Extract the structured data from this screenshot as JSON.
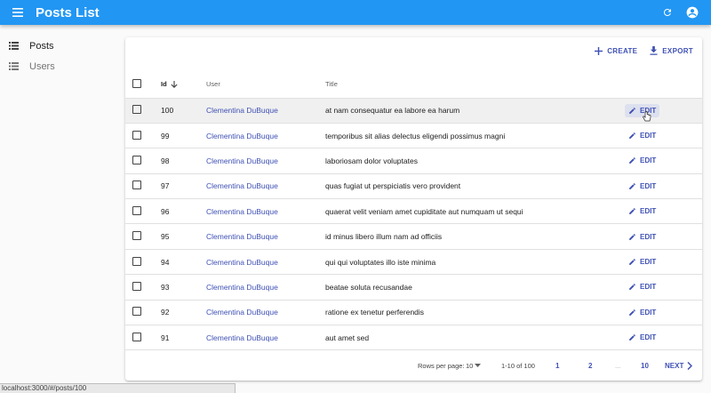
{
  "header": {
    "title": "Posts List",
    "menu_icon": "menu-icon",
    "refresh_icon": "refresh-icon",
    "account_icon": "account-circle-icon"
  },
  "sidebar": {
    "items": [
      {
        "label": "Posts",
        "icon": "list-icon",
        "active": true
      },
      {
        "label": "Users",
        "icon": "list-icon",
        "active": false
      }
    ]
  },
  "toolbar": {
    "create_label": "CREATE",
    "export_label": "EXPORT"
  },
  "table": {
    "columns": {
      "id": "Id",
      "user": "User",
      "title": "Title"
    },
    "sort": {
      "column": "Id",
      "direction": "desc"
    },
    "edit_label": "EDIT",
    "rows": [
      {
        "id": "100",
        "user": "Clementina DuBuque",
        "title": "at nam consequatur ea labore ea harum"
      },
      {
        "id": "99",
        "user": "Clementina DuBuque",
        "title": "temporibus sit alias delectus eligendi possimus magni"
      },
      {
        "id": "98",
        "user": "Clementina DuBuque",
        "title": "laboriosam dolor voluptates"
      },
      {
        "id": "97",
        "user": "Clementina DuBuque",
        "title": "quas fugiat ut perspiciatis vero provident"
      },
      {
        "id": "96",
        "user": "Clementina DuBuque",
        "title": "quaerat velit veniam amet cupiditate aut numquam ut sequi"
      },
      {
        "id": "95",
        "user": "Clementina DuBuque",
        "title": "id minus libero illum nam ad officiis"
      },
      {
        "id": "94",
        "user": "Clementina DuBuque",
        "title": "qui qui voluptates illo iste minima"
      },
      {
        "id": "93",
        "user": "Clementina DuBuque",
        "title": "beatae soluta recusandae"
      },
      {
        "id": "92",
        "user": "Clementina DuBuque",
        "title": "ratione ex tenetur perferendis"
      },
      {
        "id": "91",
        "user": "Clementina DuBuque",
        "title": "aut amet sed"
      }
    ]
  },
  "pagination": {
    "rows_per_page_label": "Rows per page:",
    "rows_per_page_value": "10",
    "range": "1-10 of 100",
    "pages": [
      "1",
      "2",
      "...",
      "10"
    ],
    "next_label": "NEXT"
  },
  "status_bar": {
    "url": "localhost:3000/#/posts/100"
  },
  "colors": {
    "appbar": "#2196f3",
    "primary": "#3f51b5"
  }
}
